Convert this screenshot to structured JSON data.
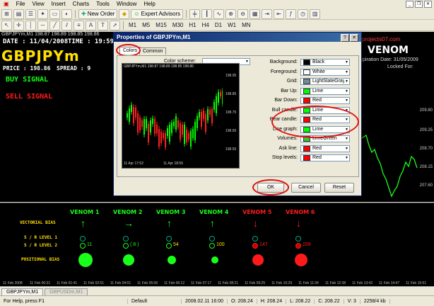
{
  "menu": [
    "File",
    "View",
    "Insert",
    "Charts",
    "Tools",
    "Window",
    "Help"
  ],
  "toolbar": {
    "new_order": "New Order",
    "expert_advisors": "Expert Advisors",
    "timeframes": [
      "M1",
      "M5",
      "M15",
      "M30",
      "H1",
      "H4",
      "D1",
      "W1",
      "MN"
    ]
  },
  "chart": {
    "title": "GBPJPYm,M1  198.87 198.89 198.85 198.86",
    "date_line": "DATE : 11/04/2008",
    "time_line": "TIME : 19:59",
    "pair": "GBPJPYm",
    "price_line": "PRICE : 198.86",
    "spread_line": "SPREAD : 9",
    "buy_signal": "BUY SIGNAL",
    "sell_signal": "SELL SIGNAL",
    "venom_title": "VENOM",
    "project_text": "projects07.com",
    "expiration": "Expiration Date: 31/05/2009",
    "locked": "Locked For:",
    "prices": [
      "209.80",
      "209.25",
      "208.70",
      "208.15",
      "207.60"
    ]
  },
  "indicator_panel": {
    "labels": {
      "vectorial": "VECTORIAL BIAS",
      "level1": "S / R LEVEL 1",
      "level2": "S / R LEVEL 2",
      "positional": "POSITIONAL BIAS"
    },
    "venoms": [
      {
        "name": "VENOM 1",
        "color": "#19ff19",
        "arrow": "↑",
        "l2": "11",
        "dot": 10
      },
      {
        "name": "VENOM 2",
        "color": "#19ff19",
        "arrow": "→",
        "l2": "( 8 )",
        "dot": 8
      },
      {
        "name": "VENOM 3",
        "color": "#19ff19",
        "arrow": "↑",
        "l2": "54",
        "dot": 6
      },
      {
        "name": "VENOM 4",
        "color": "#19ff19",
        "arrow": "↑",
        "l2": "100",
        "dot": 5
      },
      {
        "name": "VENOM 5",
        "color": "#ff1a1a",
        "arrow": "↓",
        "l2": "147",
        "dot": 8
      },
      {
        "name": "VENOM 6",
        "color": "#ff1a1a",
        "arrow": "↓",
        "l2": "159",
        "dot": 9
      }
    ]
  },
  "time_axis": [
    "11 Feb 2008",
    "11 Feb 00:31",
    "11 Feb 01:41",
    "11 Feb 02:51",
    "11 Feb 04:01",
    "11 Feb 05:06",
    "11 Feb 06:12",
    "11 Feb 07:17",
    "11 Feb 08:21",
    "11 Feb 09:25",
    "11 Feb 10:29",
    "11 Feb 11:34",
    "11 Feb 12:38",
    "11 Feb 13:42",
    "11 Feb 14:47",
    "11 Feb 15:51"
  ],
  "tabs": [
    "GBPJPYm,M1",
    "GBPUSDm,M1"
  ],
  "status": {
    "help": "For Help, press F1",
    "profile": "Default",
    "datetime": "2008.02.11 16:00",
    "open": "O: 208.24",
    "high": "H: 208.24",
    "low": "L: 208.22",
    "close": "C: 208.22",
    "volume": "V: 3",
    "traffic": "2258/4 kb"
  },
  "dialog": {
    "title": "Properties of GBPJPYm,M1",
    "tabs": [
      "Colors",
      "Common"
    ],
    "color_scheme_label": "Color scheme:",
    "preview_title": "GBPJPYm,M1  198.87 198.89 198.85 198.86",
    "preview_prices": [
      "198.95",
      "198.85",
      "198.75",
      "198.65",
      "198.55"
    ],
    "preview_dates": [
      "11 Apr 17:52",
      "11 Apr 18:56"
    ],
    "fields": [
      {
        "label": "Background:",
        "value": "Black",
        "color": "#000000"
      },
      {
        "label": "Foreground:",
        "value": "White",
        "color": "#ffffff"
      },
      {
        "label": "Grid:",
        "value": "LightSlateGray",
        "color": "#778899"
      },
      {
        "label": "Bar Up:",
        "value": "Lime",
        "color": "#00ff00"
      },
      {
        "label": "Bar Down:",
        "value": "Red",
        "color": "#ff0000"
      },
      {
        "label": "Bull candle:",
        "value": "Lime",
        "color": "#00ff00"
      },
      {
        "label": "Bear candle:",
        "value": "Red",
        "color": "#ff0000"
      },
      {
        "label": "Line graph:",
        "value": "Lime",
        "color": "#00ff00"
      },
      {
        "label": "Volumes:",
        "value": "LimeGreen",
        "color": "#32cd32"
      },
      {
        "label": "Ask line:",
        "value": "Red",
        "color": "#ff0000"
      },
      {
        "label": "Stop levels:",
        "value": "Red",
        "color": "#ff0000"
      }
    ],
    "ok": "OK",
    "cancel": "Cancel",
    "reset": "Reset"
  }
}
